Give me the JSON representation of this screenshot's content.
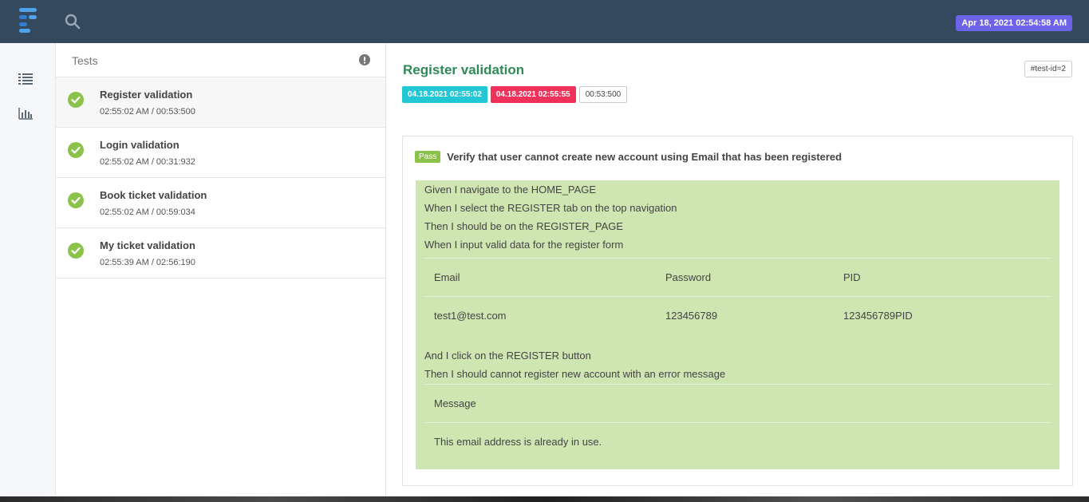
{
  "header": {
    "timestamp": "Apr 18, 2021 02:54:58 AM"
  },
  "test_list": {
    "title": "Tests",
    "items": [
      {
        "name": "Register validation",
        "time": "02:55:02 AM / 00:53:500",
        "status": "pass"
      },
      {
        "name": "Login validation",
        "time": "02:55:02 AM / 00:31:932",
        "status": "pass"
      },
      {
        "name": "Book ticket validation",
        "time": "02:55:02 AM / 00:59:034",
        "status": "pass"
      },
      {
        "name": "My ticket validation",
        "time": "02:55:39 AM / 02:56:190",
        "status": "pass"
      }
    ]
  },
  "detail": {
    "title": "Register validation",
    "test_id": "#test-id=2",
    "start": "04.18.2021 02:55:02",
    "end": "04.18.2021 02:55:55",
    "duration": "00:53:500",
    "scenario": {
      "status": "Pass",
      "name": "Verify that user cannot create new account using Email that has been registered",
      "steps_a": [
        "Given I navigate to the HOME_PAGE",
        "When I select the REGISTER tab on the top navigation",
        "Then I should be on the REGISTER_PAGE",
        "When I input valid data for the register form"
      ],
      "table1": {
        "headers": [
          "Email",
          "Password",
          "PID"
        ],
        "row": [
          "test1@test.com",
          "123456789",
          "123456789PID"
        ]
      },
      "steps_b": [
        "And I click on the REGISTER button",
        "Then I should cannot register new account with an error message"
      ],
      "table2": {
        "header": "Message",
        "value": "This email address is already in use."
      }
    }
  },
  "colors": {
    "topbar": "#35495e",
    "accent": "#6c63e8",
    "pass": "#8bc34a",
    "start_badge": "#22c7d6",
    "end_badge": "#f0325a",
    "step_bg": "#cfe5b2",
    "title_green": "#2e8b57"
  }
}
